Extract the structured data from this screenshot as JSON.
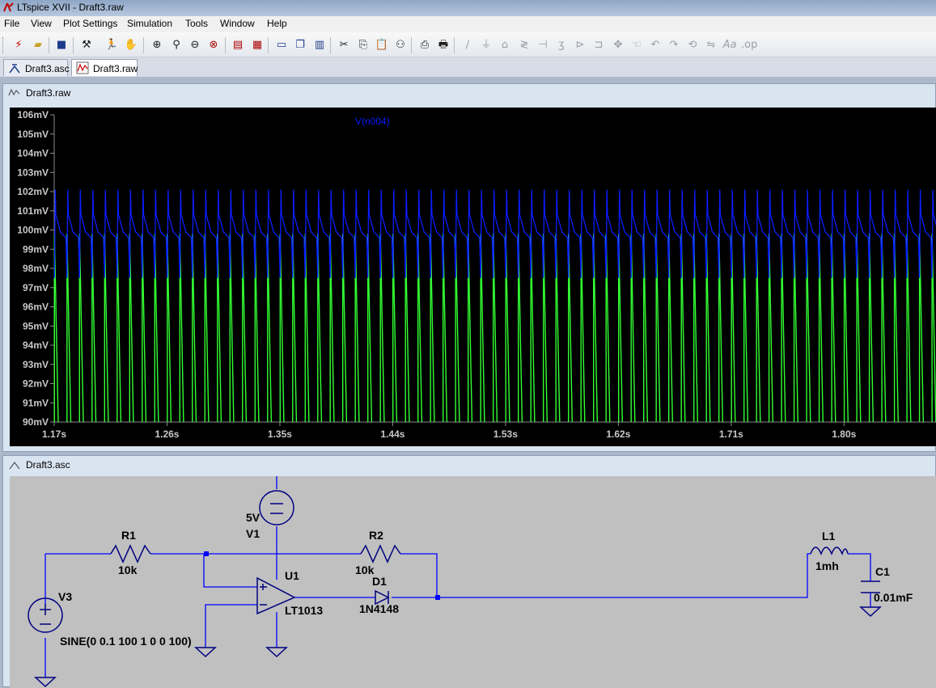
{
  "window": {
    "title": "LTspice XVII - Draft3.raw",
    "app_icon": "ltspice-logo-icon"
  },
  "menu": [
    "File",
    "View",
    "Plot Settings",
    "Simulation",
    "Tools",
    "Window",
    "Help"
  ],
  "toolbar": {
    "icons": [
      "new-schematic-icon",
      "open-icon",
      "save-icon",
      "control-panel-icon",
      "run-icon",
      "halt-icon",
      "zoom-in-icon",
      "zoom-area-icon",
      "zoom-out-icon",
      "zoom-cancel-icon",
      "autorange-icon",
      "plot-settings-icon",
      "tile-horizontal-icon",
      "cascade-icon",
      "tile-vertical-icon",
      "cut-icon",
      "copy-icon",
      "paste-icon",
      "find-icon",
      "print-preview-icon",
      "print-icon",
      "wire-icon",
      "ground-icon",
      "label-net-icon",
      "resistor-icon",
      "capacitor-icon",
      "inductor-icon",
      "diode-icon",
      "component-icon",
      "move-icon",
      "drag-icon",
      "undo-icon",
      "redo-icon",
      "rotate-icon",
      "mirror-icon",
      "text-icon",
      "spice-directive-icon"
    ]
  },
  "tabs": [
    {
      "label": "Draft3.asc",
      "icon": "schematic-icon",
      "active": false
    },
    {
      "label": "Draft3.raw",
      "icon": "waveform-icon",
      "active": true
    }
  ],
  "plot_window": {
    "title": "Draft3.raw",
    "icon": "waveform-icon"
  },
  "chart_data": {
    "type": "line",
    "title": "",
    "background": "#000000",
    "xlabel": "",
    "ylabel": "",
    "x_ticks": [
      "1.17s",
      "1.26s",
      "1.35s",
      "1.44s",
      "1.53s",
      "1.62s",
      "1.71s",
      "1.80s"
    ],
    "y_ticks": [
      "106mV",
      "105mV",
      "104mV",
      "103mV",
      "102mV",
      "101mV",
      "100mV",
      "99mV",
      "98mV",
      "97mV",
      "96mV",
      "95mV",
      "94mV",
      "93mV",
      "92mV",
      "91mV",
      "90mV"
    ],
    "xlim": [
      1.17,
      1.874
    ],
    "ylim": [
      90,
      106
    ],
    "y_unit": "mV",
    "grid": false,
    "period_s": 0.01,
    "series": [
      {
        "name": "V(n004)",
        "color": "#0a1eff",
        "min_mV": 97.5,
        "max_mV": 102.1,
        "shape": "sawtooth-spike"
      },
      {
        "name": "",
        "color": "#33ff33",
        "min_mV": 90,
        "max_mV": 99.8,
        "shape": "spike"
      }
    ]
  },
  "schematic_window": {
    "title": "Draft3.asc",
    "icon": "schematic-icon",
    "components": [
      {
        "ref": "R1",
        "value": "10k"
      },
      {
        "ref": "R2",
        "value": "10k"
      },
      {
        "ref": "V1",
        "value": "5V"
      },
      {
        "ref": "V3",
        "value": "SINE(0 0.1 100 1 0 0 100)"
      },
      {
        "ref": "U1",
        "value": "LT1013"
      },
      {
        "ref": "D1",
        "value": "1N4148"
      },
      {
        "ref": "L1",
        "value": "1mh"
      },
      {
        "ref": "C1",
        "value": "0.01mF"
      }
    ],
    "wire_color": "#0000ff",
    "component_color": "#000080"
  }
}
